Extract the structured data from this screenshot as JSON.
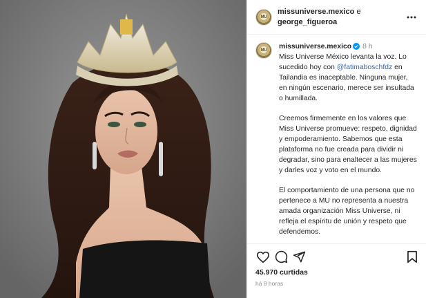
{
  "header": {
    "account": "missuniverse.mexico",
    "connector": "e",
    "coauthor": "george_figueroa",
    "avatar_text": "MU"
  },
  "caption": {
    "username": "missuniverse.mexico",
    "timestamp": "8 h",
    "para1_a": "Miss Universe México levanta la voz. Lo sucedido hoy con ",
    "para1_mention": "@fatimaboschfdz",
    "para1_b": " en Tailandia es inaceptable. Ninguna mujer, en ningún escenario, merece ser insultada o humillada.",
    "para2": "Creemos firmemente en los valores que Miss Universe promueve: respeto, dignidad y empoderamiento. Sabemos que esta plataforma no fue creada para dividir ni degradar, sino para enaltecer a las mujeres y darles voz y voto en el mundo.",
    "para3": "El comportamiento de una persona que no pertenece a MU no representa a nuestra amada organización Miss Universe, ni refleja el espíritu de unión y respeto que defendemos."
  },
  "actions": {
    "like_icon": "heart-icon",
    "comment_icon": "comment-icon",
    "share_icon": "share-icon",
    "save_icon": "bookmark-icon"
  },
  "stats": {
    "likes": "45.970 curtidas",
    "posted": "há 8 horas"
  },
  "colors": {
    "mention": "#3366aa",
    "verified": "#0095f6",
    "muted": "#8e8e8e"
  }
}
